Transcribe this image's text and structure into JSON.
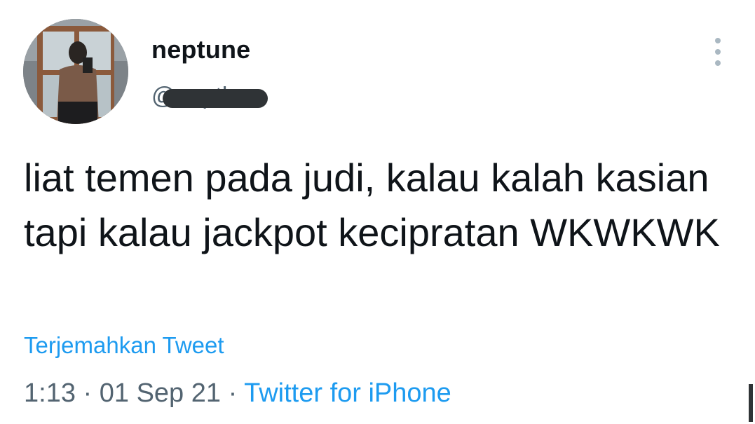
{
  "user": {
    "display_name": "neptune",
    "handle": "@neptha"
  },
  "tweet": {
    "text": "liat temen pada judi, kalau kalah kasian tapi kalau jackpot kecipratan WKWKWK",
    "translate_label": "Terjemahkan Tweet"
  },
  "meta": {
    "time": "1:13",
    "separator": "·",
    "date": "01 Sep 21",
    "source": "Twitter for iPhone"
  },
  "icons": {
    "more": "more-vertical-icon"
  },
  "colors": {
    "link": "#1d9bf0",
    "secondary": "#536471",
    "text": "#0f1419"
  }
}
